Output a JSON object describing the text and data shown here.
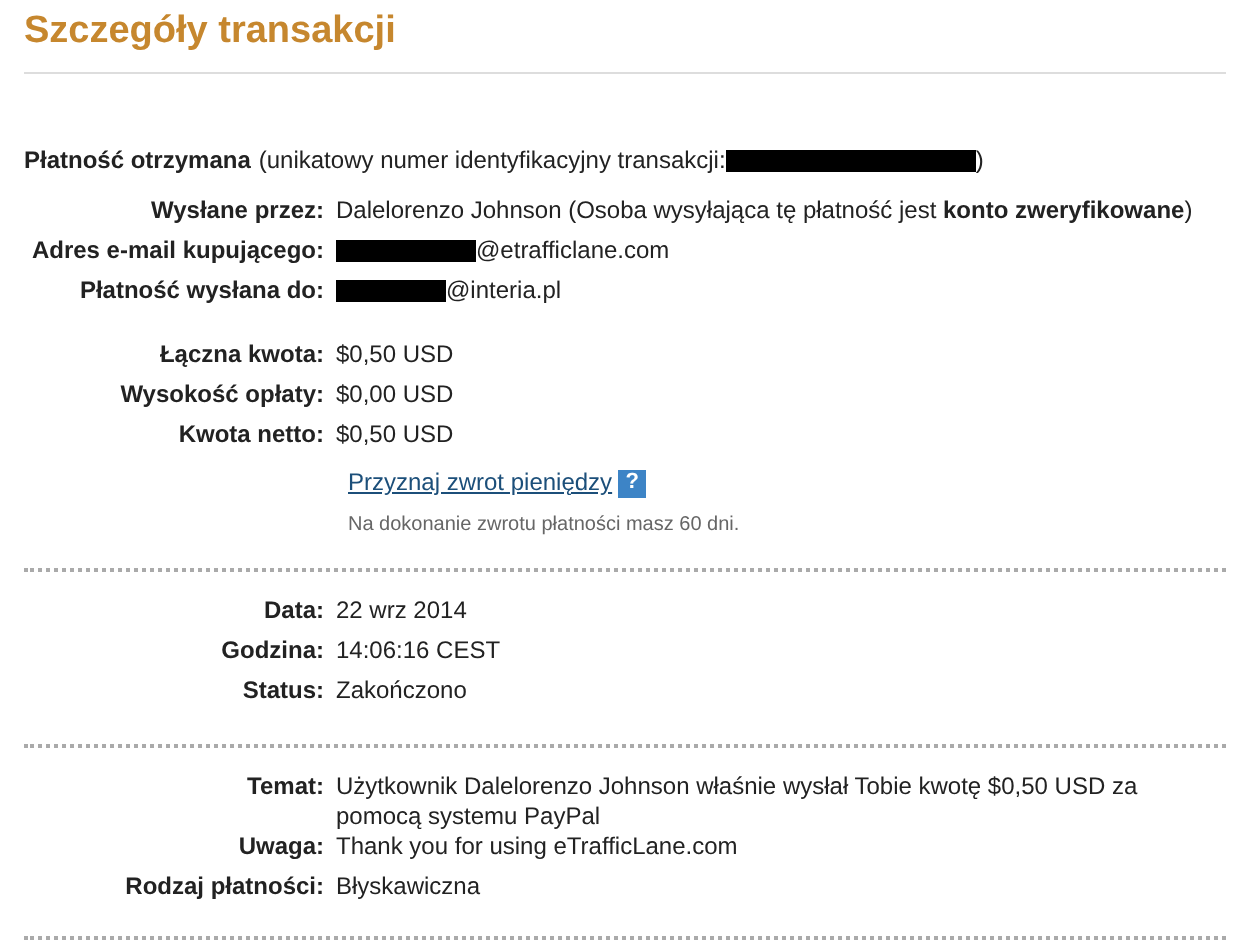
{
  "title": "Szczegóły transakcji",
  "header": {
    "label": "Płatność otrzymana",
    "text": "(unikatowy numer identyfikacyjny transakcji:",
    "redacted": true,
    "closing": ")"
  },
  "sections": [
    {
      "rows": [
        {
          "label": "Wysłane przez:",
          "value": "Dalelorenzo Johnson (Osoba wysyłająca tę płatność jest **konto zweryfikowane**)",
          "redacted": false
        },
        {
          "label": "Adres e-mail kupującego:",
          "value": "@etrafficlane.com",
          "redacted": true
        },
        {
          "label": "Płatność wysłana do:",
          "value": "@interia.pl",
          "redacted": true
        }
      ]
    },
    {
      "rows": [
        {
          "label": "Łączna kwota:",
          "value": "$0,50 USD",
          "redacted": false
        },
        {
          "label": "Wysokość opłaty:",
          "value": "$0,00 USD",
          "redacted": false
        },
        {
          "label": "Kwota netto:",
          "value": "$0,50 USD",
          "redacted": false
        }
      ],
      "link": "Przyznaj zwrot pieniędzy",
      "help": "?",
      "note": "Na dokonanie zwrotu płatności masz 60 dni."
    }
  ],
  "details": [
    {
      "rows": [
        {
          "label": "Data:",
          "value": "22 wrz 2014",
          "redacted": false
        },
        {
          "label": "Godzina:",
          "value": "14:06:16 CEST",
          "redacted": false
        },
        {
          "label": "Status:",
          "value": "Zakończono",
          "redacted": false
        }
      ]
    },
    {
      "rows": [
        {
          "label": "Temat:",
          "value": "Użytkownik Dalelorenzo Johnson właśnie wysłał Tobie kwotę $0,50 USD za pomocą systemu PayPal",
          "redacted": false
        },
        {
          "label": "Uwaga:",
          "value": "Thank you for using eTrafficLane.com",
          "redacted": false
        },
        {
          "label": "Rodzaj płatności:",
          "value": "Błyskawiczna",
          "redacted": false
        }
      ]
    }
  ]
}
